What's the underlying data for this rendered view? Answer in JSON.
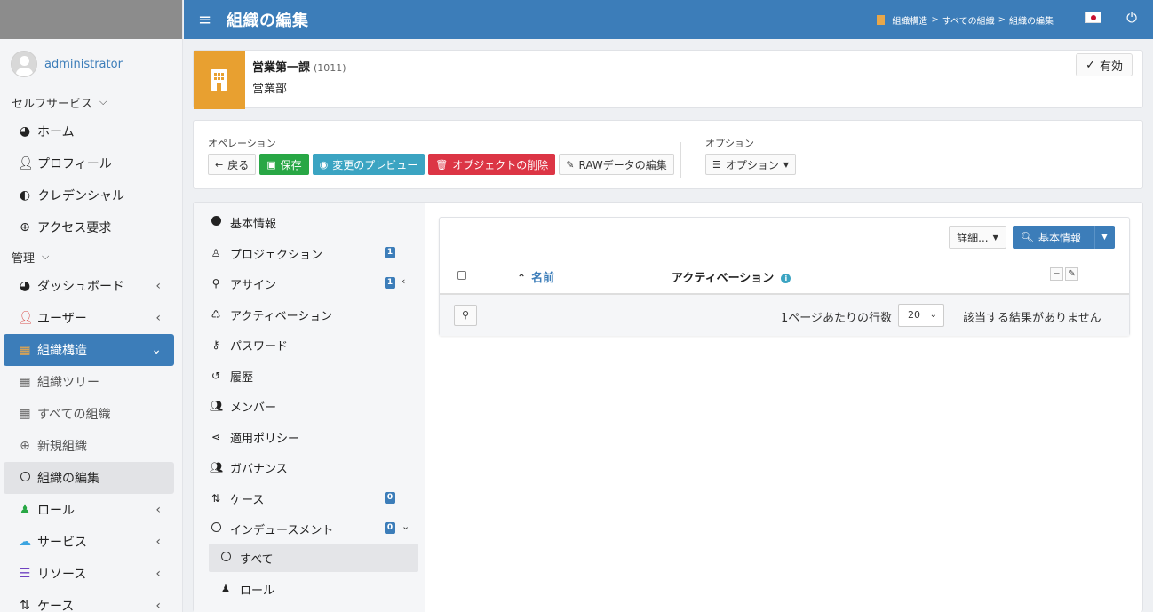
{
  "user": {
    "name": "administrator"
  },
  "sidebar": {
    "self_service": {
      "label": "セルフサービス",
      "items": [
        {
          "label": "ホーム",
          "icon": "dashboard-icon"
        },
        {
          "label": "プロフィール",
          "icon": "user-icon"
        },
        {
          "label": "クレデンシャル",
          "icon": "shield-icon"
        },
        {
          "label": "アクセス要求",
          "icon": "plus-circle-icon"
        }
      ]
    },
    "admin": {
      "label": "管理",
      "items": [
        {
          "label": "ダッシュボード",
          "icon": "dashboard-icon"
        },
        {
          "label": "ユーザー",
          "icon": "user-icon"
        },
        {
          "label": "組織構造",
          "icon": "building-icon",
          "active": true
        },
        {
          "label": "組織ツリー",
          "icon": "building-icon"
        },
        {
          "label": "すべての組織",
          "icon": "building-icon"
        },
        {
          "label": "新規組織",
          "icon": "plus-circle-icon"
        },
        {
          "label": "組織の編集",
          "icon": "circle-icon",
          "selected": true
        },
        {
          "label": "ロール",
          "icon": "role-icon"
        },
        {
          "label": "サービス",
          "icon": "cloud-icon"
        },
        {
          "label": "リソース",
          "icon": "database-icon"
        },
        {
          "label": "ケース",
          "icon": "case-icon"
        }
      ]
    }
  },
  "header": {
    "title": "組織の編集",
    "breadcrumbs": [
      "組織構造",
      "すべての組織",
      "組織の編集"
    ],
    "separator": ">"
  },
  "org": {
    "name": "営業第一課",
    "code": "(1011)",
    "display": "営業部",
    "status": "有効"
  },
  "operations": {
    "label": "オペレーション",
    "back": "戻る",
    "save": "保存",
    "preview": "変更のプレビュー",
    "delete": "オブジェクトの削除",
    "raw": "RAWデータの編集",
    "options_label": "オプション",
    "options_button": "オプション"
  },
  "tabs": [
    {
      "label": "基本情報",
      "icon": "dot-icon"
    },
    {
      "label": "プロジェクション",
      "icon": "person-icon",
      "badge": "1"
    },
    {
      "label": "アサイン",
      "icon": "assign-icon",
      "badge": "1",
      "chevron": "‹"
    },
    {
      "label": "アクティベーション",
      "icon": "recycle-icon"
    },
    {
      "label": "パスワード",
      "icon": "key-icon"
    },
    {
      "label": "履歴",
      "icon": "history-icon"
    },
    {
      "label": "メンバー",
      "icon": "users-icon"
    },
    {
      "label": "適用ポリシー",
      "icon": "share-icon"
    },
    {
      "label": "ガバナンス",
      "icon": "users-icon"
    },
    {
      "label": "ケース",
      "icon": "case-icon",
      "badge": "0"
    },
    {
      "label": "インデュースメント",
      "icon": "circle-icon",
      "badge": "0",
      "chevron": "⌄"
    },
    {
      "label": "すべて",
      "icon": "circle-icon",
      "sub": true,
      "selected": true
    },
    {
      "label": "ロール",
      "icon": "role-icon",
      "sub": true
    }
  ],
  "table": {
    "detail_button": "詳細...",
    "search_button": "基本情報",
    "col_name": "名前",
    "col_activation": "アクティベーション",
    "rows_per_page_label": "1ページあたりの行数",
    "rows_per_page": "20",
    "no_results": "該当する結果がありません"
  },
  "colors": {
    "primary": "#3c7db9",
    "org_accent": "#e8a030",
    "save": "#28a745",
    "preview": "#3ba4c2",
    "delete": "#dc3545"
  }
}
